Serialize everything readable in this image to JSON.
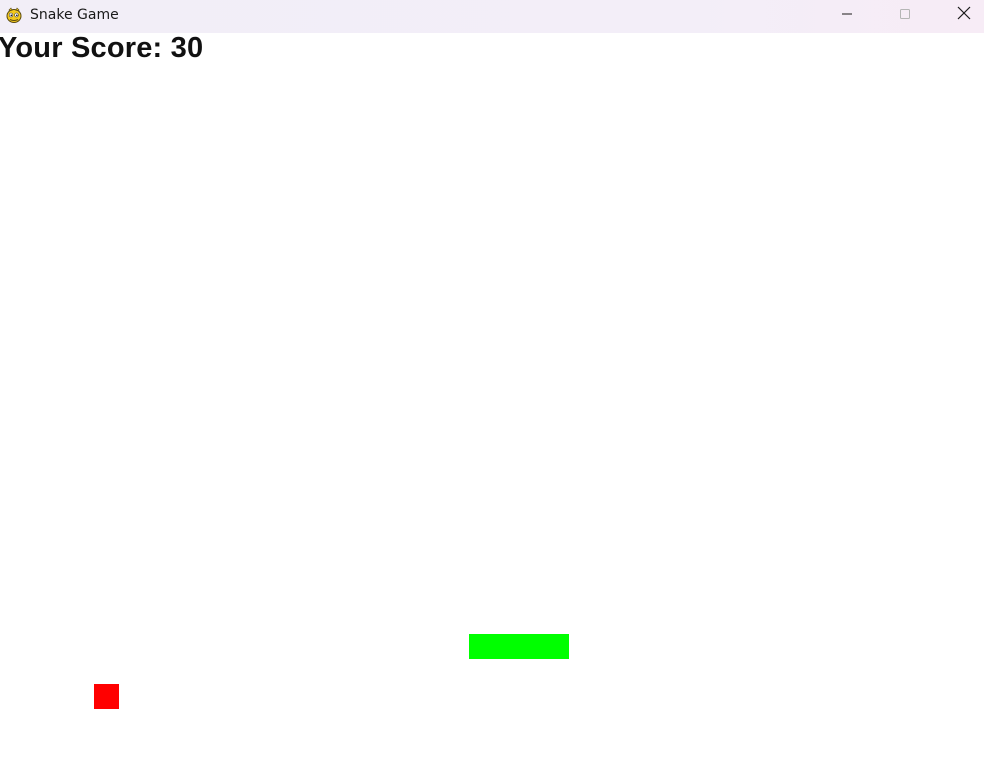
{
  "window": {
    "title": "Snake Game",
    "icon": "pygame-snake-icon"
  },
  "controls": {
    "minimize_icon": "minimize-icon",
    "maximize_icon": "maximize-icon",
    "close_icon": "close-icon"
  },
  "game": {
    "score_text": "Your Score: 30",
    "snake_color": "#00ff00",
    "food_color": "#ff0000",
    "background_color": "#ffffff",
    "snake_length": 4
  }
}
